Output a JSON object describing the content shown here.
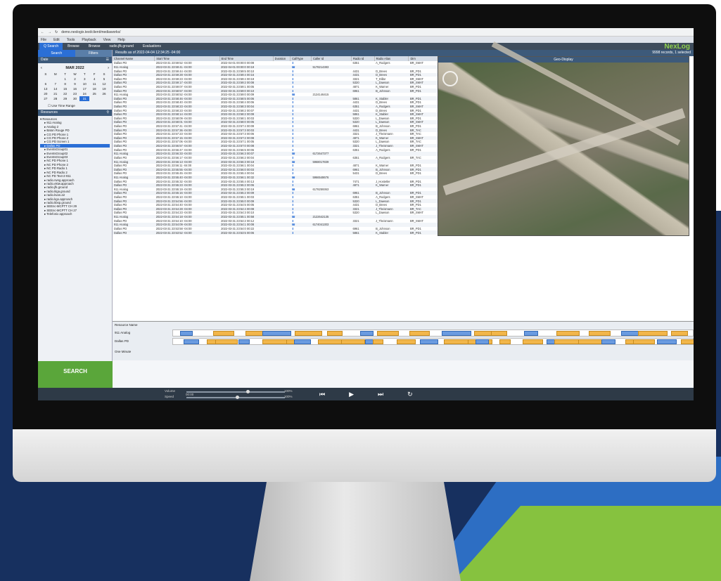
{
  "browser": {
    "url": "demo.nexlogix.test/client/mediaworks/"
  },
  "menu": [
    "File",
    "Edit",
    "Tools",
    "Playback",
    "View",
    "Help"
  ],
  "brand": "NexLog",
  "tabs": [
    "Q Search",
    "Browse",
    "Browse",
    "radio.jfk.ground",
    "Evaluations"
  ],
  "sidebar": {
    "search_tab": "Search",
    "filters_tab": "Filters",
    "date_header": "Date",
    "resources_header": "Resources",
    "time_range": "Use Time Range",
    "search_button": "SEARCH"
  },
  "calendar": {
    "month": "MAR 2022",
    "days": [
      "S",
      "M",
      "T",
      "W",
      "T",
      "F",
      "S"
    ],
    "weeks": [
      [
        "",
        "",
        "1",
        "2",
        "3",
        "4",
        "5"
      ],
      [
        "6",
        "7",
        "8",
        "9",
        "10",
        "11",
        "12"
      ],
      [
        "13",
        "14",
        "15",
        "16",
        "17",
        "18",
        "19"
      ],
      [
        "20",
        "21",
        "22",
        "23",
        "24",
        "25",
        "26"
      ],
      [
        "27",
        "28",
        "29",
        "30",
        "31",
        "",
        ""
      ]
    ],
    "selected": "31"
  },
  "resources": [
    "Resources",
    "911 Analog",
    "Analog 2",
    "Baton Rouge PD",
    "CG PD Phone 1",
    "CG PD Phone 2",
    "CG PD Screen 1",
    "Dallas PD",
    "EventsGroup01",
    "EventsGroup02",
    "EventsGroup03",
    "NC PD Phone 1",
    "NC PD Phone 2",
    "NC PD Radio 1",
    "NC PD Radio 2",
    "NC PD Text-2-911",
    "radio.rwng.approach",
    "radio.ektw.approach",
    "radio.jfk.ground",
    "radio.klga.ground",
    "radio.kvan.air",
    "radio.kgo.approach",
    "radio.kbsp.ground",
    "SEEnc-MCPTT CH 29",
    "SEEnc-MCPTT CH 27",
    "Telefonix approach"
  ],
  "results": {
    "header": "Results as of 2022-04-04 12:34:25 -04:00",
    "count": "9998 records, 1 selected",
    "columns": [
      "Channel Name",
      "Start Time",
      "End Time",
      "Duration",
      "CallType",
      "Caller Id",
      "Radio Id",
      "Radio Alias",
      "Dirn",
      "Location",
      "Cad Incident Type",
      "Cad",
      "Comment"
    ],
    "rows": [
      [
        "Dallas PD",
        "2022-03-31 23:59:52 -04:00",
        "2022-04-01 00:00:0 00:08",
        "6351",
        "A_Rodgers",
        "BR_SMAT",
        "(32.77682, 96.78319)"
      ],
      [
        "911 Analog",
        "2022-03-31 23:59:41 -04:00",
        "2022-04-01 00:00:0 00:19",
        "5178214383",
        "",
        "",
        "(29.85733, 81.89028)"
      ],
      [
        "Dallas PD",
        "2022-03-31 23:59:44 -04:00",
        "2022-03-31 23:59:5 00:10",
        "4431",
        "D_Brees",
        "BR_PD1",
        "(32.77123, 96.78792)"
      ],
      [
        "Dallas PD",
        "2022-03-31 23:59:28 -04:00",
        "2022-03-31 23:59:4 00:16",
        "4431",
        "D_Brees",
        "BR_PD1",
        "(32.77532, 96.80069)"
      ],
      [
        "Dallas PD",
        "2022-03-31 23:59:23 -04:00",
        "2022-03-31 23:59:4 00:19",
        "3321",
        "T_Dillar",
        "BR_SMAT",
        "(32.78374, 96.78850)"
      ],
      [
        "Dallas PD",
        "2022-03-31 23:59:17 -04:00",
        "2022-03-31 23:59:2 00:08",
        "5320",
        "L_Dawson",
        "BR_SMAT",
        "(32.77239, 96.79165)"
      ],
      [
        "Dallas PD",
        "2022-03-31 23:59:07 -04:00",
        "2022-03-31 23:59:1 00:05",
        "4871",
        "K_Warner",
        "BR_PD1",
        "(32.78543, 96.78323)"
      ],
      [
        "Dallas PD",
        "2022-03-31 23:58:57 -04:00",
        "2022-03-31 23:59:0 00:10",
        "6961",
        "B_Johnson",
        "BR_PD1",
        "(32.77521, 96.80249)"
      ],
      [
        "911 Analog",
        "2022-03-31 23:58:52 -04:00",
        "2022-03-31 23:59:0 00:09",
        "2124146415",
        "",
        "",
        "(28.31413, 81.35228)"
      ],
      [
        "Dallas PD",
        "2022-03-31 23:58:46 -04:00",
        "2022-03-31 23:58:5 00:06",
        "5861",
        "K_Stabler",
        "BR_PD1",
        "(32.77311, 96.80427)"
      ],
      [
        "Dallas PD",
        "2022-03-31 23:58:40 -04:00",
        "2022-03-31 23:58:4 00:06",
        "4431",
        "D_Brees",
        "BR_PD1",
        "(32.77150, 96.78218)"
      ],
      [
        "Dallas PD",
        "2022-03-31 23:58:23 -04:00",
        "2022-03-31 23:58:3 00:04",
        "6351",
        "A_Rodgers",
        "BR_SMAT",
        "(32.78303, 96.79344)"
      ],
      [
        "Dallas PD",
        "2022-03-31 23:58:23 -04:00",
        "2022-03-31 23:58:2 00:07",
        "4431",
        "D_Brees",
        "BR_PD1",
        "(32.78303, 96.79174)"
      ],
      [
        "Dallas PD",
        "2022-03-31 23:58:14 -04:00",
        "2022-03-31 23:58:2 00:09",
        "5861",
        "K_Stabler",
        "BR_SMAT",
        "(32.78203, 96.79479)"
      ],
      [
        "Dallas PD",
        "2022-03-31 23:58:09 -04:00",
        "2022-03-31 23:58:1 00:03",
        "5320",
        "L_Dawson",
        "BR_PD1",
        "(32.77421, 96.78329)"
      ],
      [
        "Dallas PD",
        "2022-03-31 23:58:01 -04:00",
        "2022-03-31 23:58:0 00:05",
        "5320",
        "L_Dawson",
        "BR_SMAT",
        "(32.78123, 96.79218)"
      ],
      [
        "Dallas PD",
        "2022-03-31 23:57:41 -04:00",
        "2022-03-31 23:57:4 00:09",
        "6961",
        "B_Johnson",
        "BR_PD1",
        "(32.77421, 96.78139)"
      ],
      [
        "Dallas PD",
        "2022-03-31 23:57:36 -04:00",
        "2022-03-31 23:57:3 00:03",
        "4431",
        "D_Brees",
        "BR_TAC",
        "(32.77693, 96.78339)"
      ],
      [
        "Dallas PD",
        "2022-03-31 23:57:23 -04:00",
        "2022-03-31 23:57:3 00:06",
        "3321",
        "J_Theismann",
        "BR_TAC",
        "(32.77421, 96.78309)"
      ],
      [
        "Dallas PD",
        "2022-03-31 23:57:15 -04:00",
        "2022-03-31 23:57:2 00:08",
        "4871",
        "K_Warner",
        "BR_SMAT",
        "(32.77144, 96.78709)"
      ],
      [
        "Dallas PD",
        "2022-03-31 23:57:06 -04:00",
        "2022-03-31 23:57:1 00:05",
        "5320",
        "L_Dawson",
        "BR_TAC",
        "(32.77421, 96.79409)"
      ],
      [
        "Dallas PD",
        "2022-03-31 23:56:57 -04:00",
        "2022-03-31 23:57:0 00:08",
        "3321",
        "J_Theismann",
        "BR_SMAT",
        "(32.77921, 96.78319)"
      ],
      [
        "Dallas PD",
        "2022-03-31 23:56:47 -04:00",
        "2022-03-31 23:56:5 00:06",
        "6351",
        "A_Rodgers",
        "BR_PD1",
        "(32.77531, 96.80429)"
      ],
      [
        "911 Analog",
        "2022-03-31 23:56:33 -04:00",
        "2022-03-31 23:56:3 00:07",
        "6172647377",
        "",
        "",
        "(28.46133, 81.34228)"
      ],
      [
        "Dallas PD",
        "2022-03-31 23:56:17 -04:00",
        "2022-03-31 23:56:2 00:04",
        "6351",
        "A_Rodgers",
        "BR_TAC",
        "(32.78021, 96.78689)"
      ],
      [
        "911 Analog",
        "2022-03-31 23:56:13 -04:00",
        "2022-03-31 23:56:3 00:18",
        "5968017839",
        "",
        "",
        "(29.67410, 81.29328)"
      ],
      [
        "Dallas PD",
        "2022-03-31 23:56:11 -04:00",
        "2022-03-31 23:56:1 00:04",
        "4871",
        "K_Warner",
        "BR_PD1",
        "(32.77891, 96.80179)"
      ],
      [
        "Dallas PD",
        "2022-03-31 23:55:55 -04:00",
        "2022-03-31 23:56:0 00:03",
        "6961",
        "B_Johnson",
        "BR_PD1",
        "(32.77314, 96.79189)"
      ],
      [
        "Dallas PD",
        "2022-03-31 23:55:45 -04:00",
        "2022-03-31 23:55:4 00:04",
        "5431",
        "D_Brees",
        "BR_PD1",
        "(32.77585, 96.78749)"
      ],
      [
        "911 Analog",
        "2022-03-31 23:55:40 -04:00",
        "2022-03-31 23:56:1 00:32",
        "5966548676",
        "",
        "",
        "(28.44013, 81.15028)"
      ],
      [
        "Dallas PD",
        "2022-03-31 23:55:32 -04:00",
        "2022-03-31 23:55:4 00:13",
        "7471",
        "J_Hostetler",
        "BR_PD1",
        "(32.78279, 96.79539)"
      ],
      [
        "Dallas PD",
        "2022-03-31 23:55:23 -04:00",
        "2022-03-31 23:55:2 00:06",
        "4871",
        "K_Warner",
        "BR_PD1",
        "(32.77603, 96.78478)"
      ],
      [
        "911 Analog",
        "2022-03-31 23:55:19 -04:00",
        "2022-03-31 23:55:3 00:19",
        "6178259363",
        "",
        "",
        "(27.90613, 81.55228)"
      ],
      [
        "Dallas PD",
        "2022-03-31 23:55:16 -04:00",
        "2022-03-31 23:55:2 00:09",
        "6961",
        "B_Johnson",
        "BR_PD1",
        "(32.77139, 96.78349)"
      ],
      [
        "Dallas PD",
        "2022-03-31 23:55:10 -04:00",
        "2022-03-31 23:55:1 00:03",
        "6351",
        "A_Rodgers",
        "BR_SMAT",
        "(32.78123, 96.78339)"
      ],
      [
        "Dallas PD",
        "2022-03-31 23:54:56 -04:00",
        "2022-03-31 23:55:0 00:09",
        "5320",
        "L_Dawson",
        "BR_PD1",
        "(32.78014, 96.78889)"
      ],
      [
        "Dallas PD",
        "2022-03-31 23:54:40 -04:00",
        "2022-03-31 23:54:5 00:05",
        "4431",
        "D_Brees",
        "BR_PD1",
        "(32.77421, 96.79229)"
      ],
      [
        "Dallas PD",
        "2022-03-31 23:54:28 -04:00",
        "2022-03-31 23:54:4 00:08",
        "3321",
        "J_Theismann",
        "BR_TAC",
        "(32.78243, 96.78109)"
      ],
      [
        "Dallas PD",
        "2022-03-31 23:54:23 -04:00",
        "2022-03-31 23:54:3 00:10",
        "5320",
        "L_Dawson",
        "BR_SMAT",
        "(32.78083, 96.79229)"
      ],
      [
        "911 Analog",
        "2022-03-31 23:54:18 -04:00",
        "2022-03-31 23:55:1 00:58",
        "2122642135",
        "",
        "",
        "(28.07103, 81.15028)"
      ],
      [
        "Dallas PD",
        "2022-03-31 23:54:10 -04:00",
        "2022-03-31 23:54:2 00:12",
        "3321",
        "J_Theismann",
        "BR_SMAT",
        "(32.78141, 96.80149)"
      ],
      [
        "911 Analog",
        "2022-03-31 23:54:09 -04:00",
        "2022-03-31 23:54:1 00:08",
        "6174041303",
        "",
        "",
        "(28.25613, 81.28428)"
      ],
      [
        "Dallas PD",
        "2022-03-31 23:53:58 -04:00",
        "2022-03-31 23:54:0 00:22",
        "6961",
        "B_Johnson",
        "BR_PD1",
        "(32.77721, 96.79329)"
      ],
      [
        "Dallas PD",
        "2022-03-31 23:53:52 -04:00",
        "2022-03-31 23:53:5 00:06",
        "5861",
        "K_Stabler",
        "BR_PD1",
        "(32.78351, 96.79379)"
      ]
    ],
    "cad_rows": [
      {
        "row": 1,
        "type": "DOMESTIC"
      },
      {
        "row": 8,
        "type": "DOMESTIC"
      },
      {
        "row": 23,
        "type": "DOMESTIC"
      },
      {
        "row": 25,
        "type": "UNKNOWN"
      },
      {
        "row": 29,
        "type": "UNKNOWN"
      },
      {
        "row": 32,
        "type": "DOMESTIC"
      },
      {
        "row": 39,
        "type": "MEDICAL"
      },
      {
        "row": 41,
        "type": "CONFIDENTIAL"
      }
    ],
    "comments": [
      "Audio Provided by Broadsoftify",
      "Not an Actual 911 Call",
      "Audio Provided by Broadsoftify",
      "Not an Actual 911 Call",
      "Audio Provided by Broadsoftify",
      "Audio Provided by Broadsoftify",
      "Not an Actual 911 Call",
      "Audio Provided by Broadsoftify"
    ]
  },
  "geo": {
    "title": "Geo-Display"
  },
  "timeline": {
    "resource_header": "Resource Name",
    "tracks": [
      "911 Analog",
      "Dallas PD"
    ],
    "zoom": "One Minute"
  },
  "player": {
    "volume": "Volume",
    "speed": "Speed",
    "vol_pct": "100%",
    "speed_pct": "100%",
    "time": "00:00"
  }
}
